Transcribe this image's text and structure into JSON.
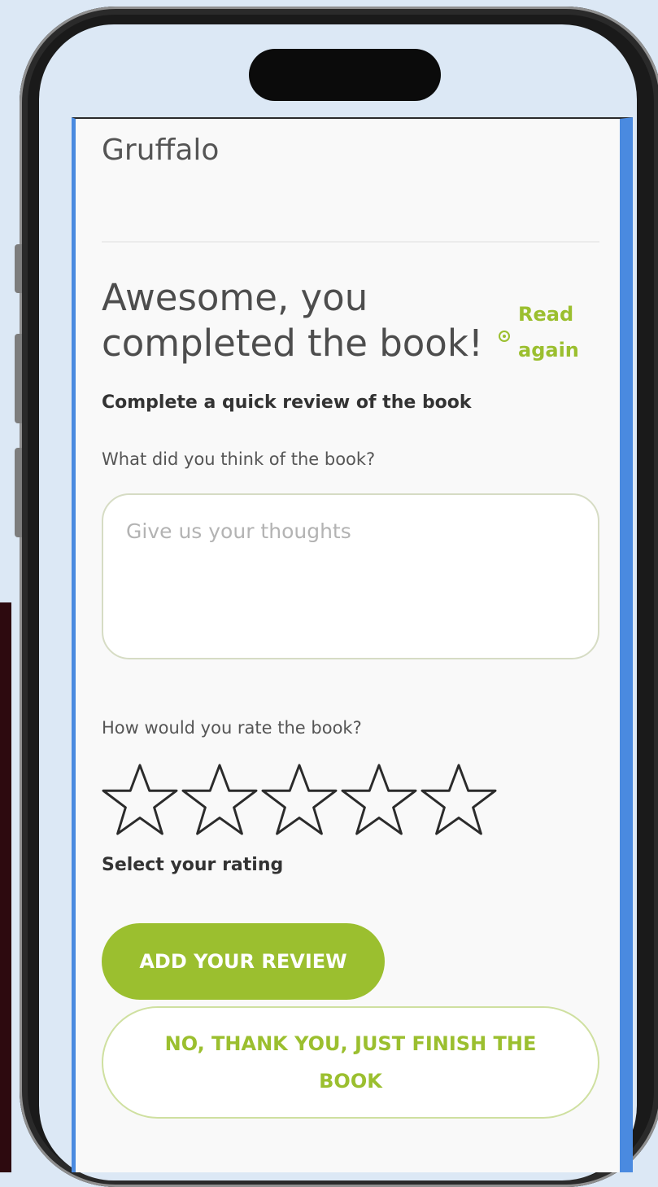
{
  "book": {
    "title": "Gruffalo"
  },
  "completion": {
    "heading": "Awesome, you completed the book!",
    "read_again_label": "Read again"
  },
  "review": {
    "subheading": "Complete a quick review of the book",
    "thoughts_question": "What did you think of the book?",
    "thoughts_placeholder": "Give us your thoughts",
    "thoughts_value": "",
    "rating_question": "How would you rate the book?",
    "rating": {
      "value": 0,
      "max": 5
    },
    "rating_hint": "Select your rating"
  },
  "actions": {
    "add_review_label": "ADD YOUR REVIEW",
    "finish_label": "NO, THANK YOU, JUST FINISH THE BOOK"
  },
  "colors": {
    "accent_green": "#9bbf2f",
    "panel_border_blue": "#4a8ae0"
  },
  "icons": {
    "read_again": "replay-icon",
    "rating": "star-outline-icon"
  }
}
